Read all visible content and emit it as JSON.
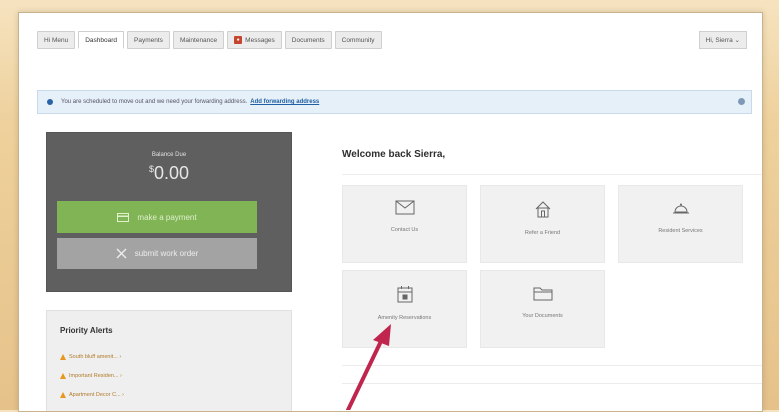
{
  "nav": {
    "tabs": [
      "Hi Menu",
      "Dashboard",
      "Payments",
      "Maintenance",
      "Messages",
      "Documents",
      "Community"
    ],
    "active_index": 1,
    "user_menu": "Hi, Sierra ⌄"
  },
  "alert": {
    "text": "You are scheduled to move out and we need your forwarding address.",
    "link": "Add forwarding address"
  },
  "balance": {
    "label": "Balance Due",
    "currency": "$",
    "amount": "0.00",
    "pay_label": "make a payment",
    "work_order_label": "submit work order"
  },
  "priority": {
    "title": "Priority Alerts",
    "items": [
      "South bluff amenit... ›",
      "Important Residen... ›",
      "Apartment Decor C... ›"
    ]
  },
  "welcome": "Welcome back Sierra,",
  "tiles": [
    {
      "label": "Contact Us",
      "icon": "envelope-icon"
    },
    {
      "label": "Refer a Friend",
      "icon": "home-icon"
    },
    {
      "label": "Resident Services",
      "icon": "service-bell-icon"
    },
    {
      "label": "Amenity Reservations",
      "icon": "calendar-icon"
    },
    {
      "label": "Your Documents",
      "icon": "folder-icon"
    }
  ],
  "colors": {
    "pay_button": "#80b455",
    "balance_panel": "#5f5f5f",
    "alert_bg": "#e6f0f8",
    "arrow": "#c0254d"
  }
}
